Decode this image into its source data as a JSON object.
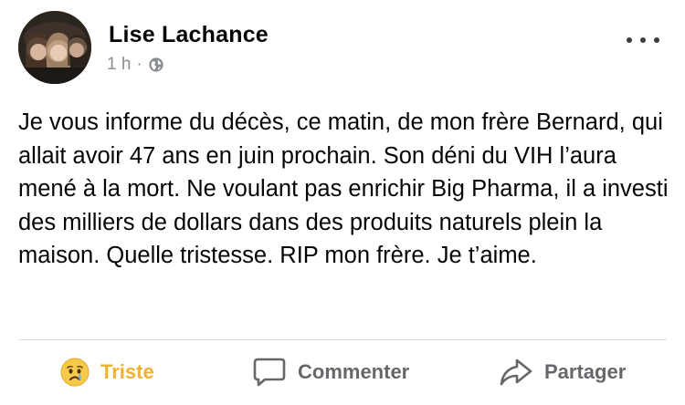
{
  "post": {
    "author": "Lise Lachance",
    "time": "1 h",
    "separator": "·",
    "privacy_icon": "globe-icon",
    "more_icon": "more-options-icon",
    "text": "Je vous informe du décès, ce matin, de mon frère Bernard, qui allait avoir 47 ans en juin prochain. Son déni du VIH l’aura mené à la mort. Ne voulant pas enrichir Big Pharma, il a investi des milliers de dollars dans des produits naturels plein la maison. Quelle tristesse. RIP mon frère. Je t’aime."
  },
  "actions": {
    "react_label": "Triste",
    "react_icon": "sad-face-icon",
    "comment_label": "Commenter",
    "comment_icon": "comment-bubble-icon",
    "share_label": "Partager",
    "share_icon": "share-arrow-icon"
  },
  "colors": {
    "reaction_sad": "#f0b12e",
    "action_gray": "#65676b",
    "meta_gray": "#8a8d91",
    "text": "#050505"
  }
}
